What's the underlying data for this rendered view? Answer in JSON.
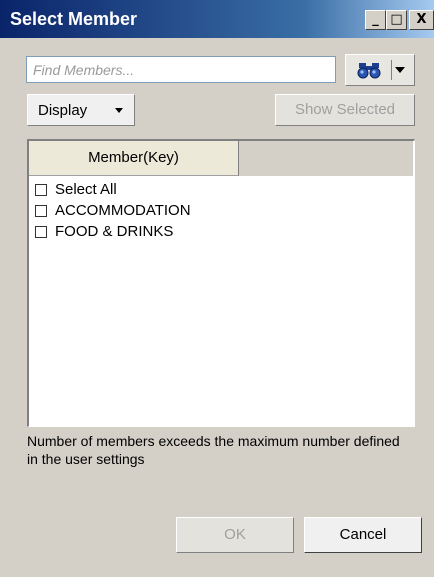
{
  "window": {
    "title": "Select Member",
    "minimize_label": "_",
    "maximize_label": "□",
    "close_label": "X"
  },
  "search": {
    "placeholder": "Find Members...",
    "value": ""
  },
  "toolbar": {
    "display_label": "Display",
    "show_selected_label": "Show Selected"
  },
  "list": {
    "column_header": "Member(Key)",
    "items": [
      {
        "label": "Select All",
        "checked": false
      },
      {
        "label": "ACCOMMODATION",
        "checked": false
      },
      {
        "label": "FOOD & DRINKS",
        "checked": false
      }
    ]
  },
  "message": "Number of members exceeds the maximum number defined in the user settings",
  "buttons": {
    "ok_label": "OK",
    "cancel_label": "Cancel"
  },
  "colors": {
    "title_bar": "#0a246a",
    "dialog_bg": "#d4d0c8",
    "disabled_text": "#a0a0a0"
  },
  "icons": {
    "search": "binoculars-icon",
    "dropdown": "chevron-down-icon"
  }
}
